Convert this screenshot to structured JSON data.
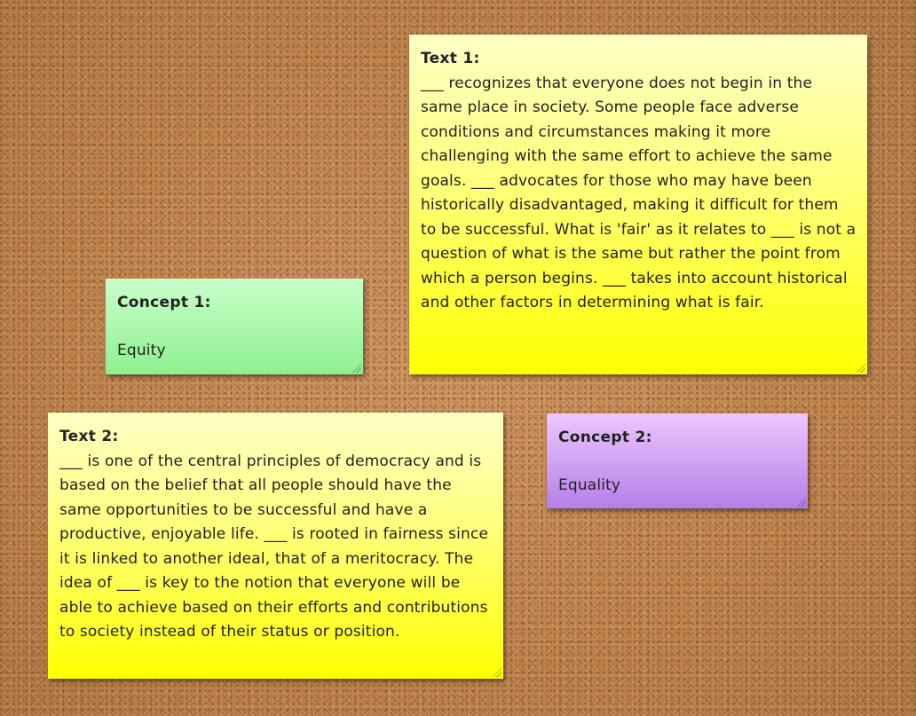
{
  "notes": {
    "text1": {
      "title": "Text 1:",
      "body": "___ recognizes that everyone does not begin in the same place in society. Some people face adverse conditions and circumstances making it more challenging with the same effort to achieve the same goals. ___ advocates for those who may have been historically disadvantaged, making it difficult for them to be successful. What is 'fair' as it relates to ___ is not a question of what is the same but rather the point from which a person begins. ___ takes into account historical and other factors in determining what is fair."
    },
    "concept1": {
      "title": "Concept 1:",
      "body": "Equity"
    },
    "text2": {
      "title": "Text 2:",
      "body": "___ is one of the central principles of democracy and is based on the belief that all people should have the same opportunities to be successful and have a productive, enjoyable life. ___ is rooted in fairness since it is linked to another ideal, that of a meritocracy. The idea of ___ is key to the notion that everyone will be able to achieve based on their efforts and contributions to society instead of their status or position."
    },
    "concept2": {
      "title": "Concept 2:",
      "body": "Equality"
    }
  },
  "colors": {
    "board": "#c48a55",
    "text_note": "#ffff00",
    "concept1_note": "#8ef08f",
    "concept2_note": "#b57fe8"
  },
  "icons": {
    "resize_handle": "resize-grip-icon"
  }
}
